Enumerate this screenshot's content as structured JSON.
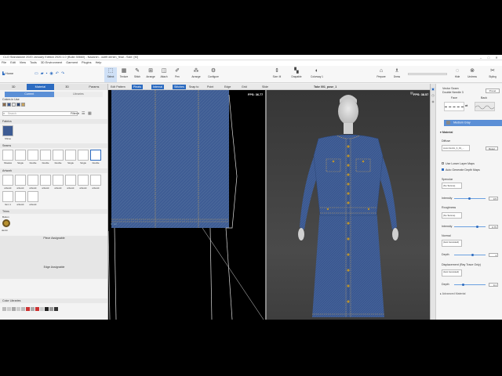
{
  "window": {
    "title": "CLO Standalone 2020 January Edition 2020.1.0 (Build 30660) - Nazanin - outfit denim_final - Size: [M]"
  },
  "menu": [
    "File",
    "Edit",
    "View",
    "Tools",
    "3D Environment",
    "Garment",
    "Plugins",
    "Help"
  ],
  "toolbar": {
    "home_label": "Home",
    "tools": [
      "Select",
      "Texture",
      "Stitch",
      "Arrange",
      "Attach",
      "Pen",
      "Arrange",
      "Configure",
      "Size: M",
      "Drapable",
      "Colorway 1",
      "Prepare",
      "Dress",
      "Simulate",
      "Hide",
      "Reset",
      "Undress",
      "Styling"
    ]
  },
  "subtoolbar": [
    "Edit Pattern",
    "Pleats",
    "Internal",
    "Stitches",
    "Snap to",
    "Point",
    "Edge",
    "Grid",
    "Slide"
  ],
  "left_panel": {
    "tabs": [
      "3D",
      "Material",
      "3D",
      "Params"
    ],
    "subtabs": [
      "Current",
      "Libraries"
    ],
    "colors_label": "Colors in Use",
    "search_placeholder": "Search",
    "filter_label": "Filter",
    "fabrics_label": "Fabrics",
    "fabric_item": "Shirue",
    "seams_label": "Seams",
    "seam_items": [
      "Shadow",
      "Single",
      "Double",
      "Double",
      "Double",
      "Single",
      "Single",
      "Double"
    ],
    "artwork_label": "Artwork",
    "artwork_items": [
      "artwork",
      "artwork",
      "artwork",
      "artwork",
      "artwork",
      "artwork",
      "artwork",
      "artwork",
      "Item 1",
      "artwork",
      "artwork"
    ],
    "trims_label": "Trims",
    "button_label": "Button",
    "trim_item": "denim",
    "piece_assignable": "Piece Assignable",
    "edge_assignable": "Edge Assignable",
    "color_libraries": "Color Libraries"
  },
  "view2d": {
    "fps": "FPS: 36.77",
    "size_label": "X: 1/2"
  },
  "view3d": {
    "title": "Take 001_pose_1",
    "fps": "FPS: 38.57"
  },
  "right_panel": {
    "object_title": "Vector Seam",
    "object_sub": "Double Needle 3",
    "preset_btn": "Preset",
    "face_label": "Face",
    "back_label": "Back",
    "colorway_name": "Medium Gray",
    "material_header": "Material",
    "diffuse_label": "Diffuse",
    "texture_file": "cover denim_b_01_...",
    "reset_btn": "Reset",
    "use_lower": "Use Lower Layer Maps",
    "auto_depth": "Auto Generate Depth Maps",
    "specular_label": "Specular",
    "no_texture": "(No Texture)",
    "intensity_label": "Intensity",
    "specular_intensity": "0.5",
    "roughness_label": "Roughness",
    "roughness_value": "0.75",
    "normal_label": "Normal",
    "normal_tex": "(Auto Generated)",
    "depth_label": "Depth",
    "normal_depth": "1",
    "displacement_label": "Displacement (Ray Trace Only)",
    "disp_tex": "(Auto Generated)",
    "disp_depth": "0.1",
    "advanced_label": "Advanced Material"
  },
  "colors": {
    "accent": "#2c6bc0",
    "denim": "#3d5b93",
    "denim_dark": "#2c4677",
    "stitch": "#c9a25b",
    "button": "#b8912f"
  }
}
